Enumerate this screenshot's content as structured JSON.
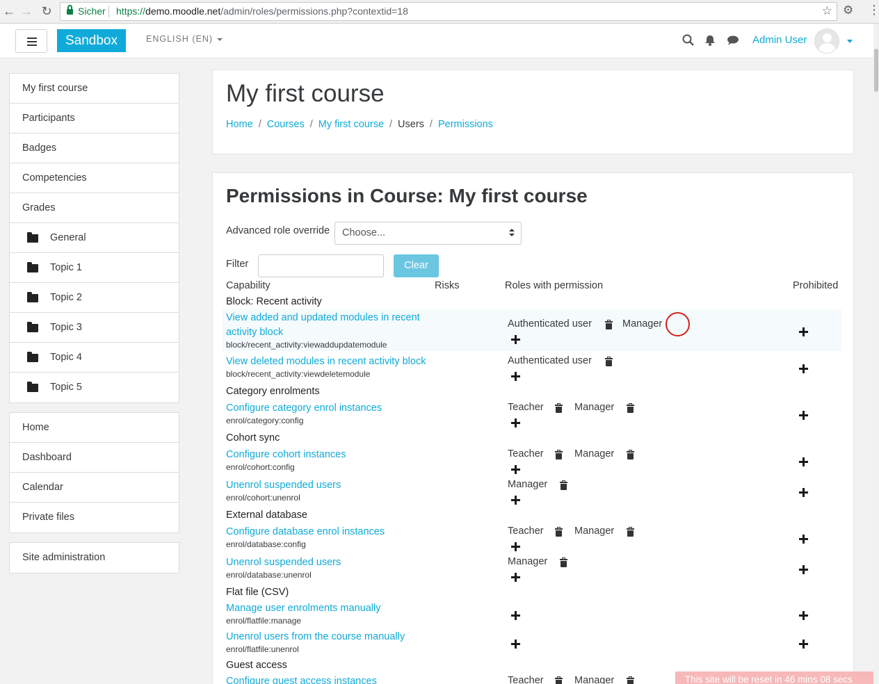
{
  "browser": {
    "secure_label": "Sicher",
    "url_scheme": "https://",
    "url_host": "demo.moodle.net",
    "url_path": "/admin/roles/permissions.php?contextid=18"
  },
  "navbar": {
    "brand": "Sandbox",
    "language": "ENGLISH (EN)",
    "user": "Admin User"
  },
  "drawer": {
    "course": [
      {
        "label": "My first course",
        "icon": ""
      },
      {
        "label": "Participants",
        "icon": ""
      },
      {
        "label": "Badges",
        "icon": ""
      },
      {
        "label": "Competencies",
        "icon": ""
      },
      {
        "label": "Grades",
        "icon": ""
      },
      {
        "label": "General",
        "icon": "folder-icon"
      },
      {
        "label": "Topic 1",
        "icon": "folder-icon"
      },
      {
        "label": "Topic 2",
        "icon": "folder-icon"
      },
      {
        "label": "Topic 3",
        "icon": "folder-icon"
      },
      {
        "label": "Topic 4",
        "icon": "folder-icon"
      },
      {
        "label": "Topic 5",
        "icon": "folder-icon"
      }
    ],
    "site": [
      "Home",
      "Dashboard",
      "Calendar",
      "Private files"
    ],
    "admin": "Site administration"
  },
  "header": {
    "title": "My first course",
    "breadcrumb": [
      "Home",
      "Courses",
      "My first course",
      "Users",
      "Permissions"
    ]
  },
  "permissions": {
    "title": "Permissions in Course: My first course",
    "override_label": "Advanced role override",
    "override_value": "Choose...",
    "filter_label": "Filter",
    "filter_value": "",
    "clear_label": "Clear",
    "columns": {
      "capability": "Capability",
      "risks": "Risks",
      "roles": "Roles with permission",
      "prohibited": "Prohibited"
    },
    "groups": [
      "Block: Recent activity",
      "Category enrolments",
      "Cohort sync",
      "External database",
      "Flat file (CSV)",
      "Guest access"
    ],
    "rows": [
      {
        "name_line1": "View added and updated modules in recent",
        "name_line2": "activity block",
        "id": "block/recent_activity:viewaddupdatemodule",
        "roles": [
          "Authenticated user",
          "Manager"
        ]
      },
      {
        "name_line1": "View deleted modules in recent activity block",
        "id": "block/recent_activity:viewdeletemodule",
        "roles": [
          "Authenticated user"
        ]
      },
      {
        "name_line1": "Configure category enrol instances",
        "id": "enrol/category:config",
        "roles": [
          "Teacher",
          "Manager"
        ]
      },
      {
        "name_line1": "Configure cohort instances",
        "id": "enrol/cohort:config",
        "roles": [
          "Teacher",
          "Manager"
        ]
      },
      {
        "name_line1": "Unenrol suspended users",
        "id": "enrol/cohort:unenrol",
        "roles": [
          "Manager"
        ]
      },
      {
        "name_line1": "Configure database enrol instances",
        "id": "enrol/database:config",
        "roles": [
          "Teacher",
          "Manager"
        ]
      },
      {
        "name_line1": "Unenrol suspended users",
        "id": "enrol/database:unenrol",
        "roles": [
          "Manager"
        ]
      },
      {
        "name_line1": "Manage user enrolments manually",
        "id": "enrol/flatfile:manage",
        "roles": []
      },
      {
        "name_line1": "Unenrol users from the course manually",
        "id": "enrol/flatfile:unenrol",
        "roles": []
      },
      {
        "name_line1": "Configure guest access instances",
        "id": "",
        "roles": [
          "Teacher",
          "Manager"
        ]
      }
    ]
  },
  "notice": "This site will be reset in 46 mins 08 secs"
}
